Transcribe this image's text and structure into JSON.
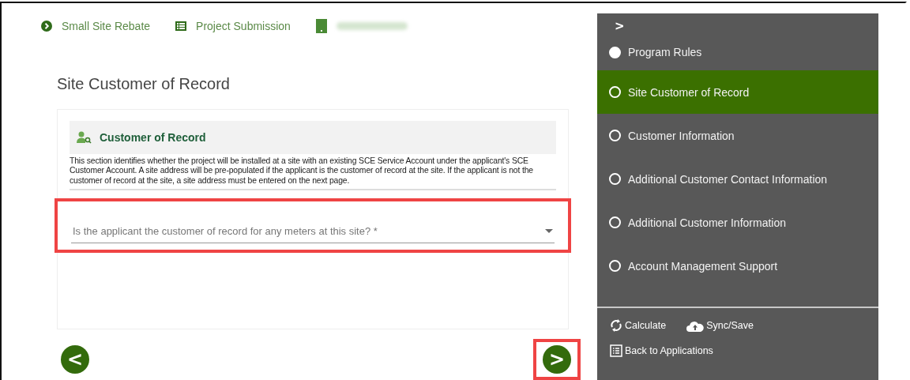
{
  "breadcrumbs": [
    {
      "label": "Small Site Rebate",
      "kind": "chevron"
    },
    {
      "label": "Project Submission",
      "kind": "list"
    },
    {
      "kind": "redacted"
    }
  ],
  "page_title": "Site Customer of Record",
  "section": {
    "title": "Customer of Record",
    "description": "This section identifies whether the project will be installed at a site with an existing SCE Service Account under the applicant's SCE Customer Account. A site address will be pre-populated if the applicant is the customer of record at the site. If the applicant is not the customer of record at the site, a site address must be entered on the next page."
  },
  "question": {
    "placeholder": "Is the applicant the customer of record for any meters at this site? *",
    "highlighted": true
  },
  "nav": {
    "prev": {
      "label": "<",
      "highlighted": false
    },
    "next": {
      "label": ">",
      "highlighted": true
    }
  },
  "sidebar": {
    "toggle": ">",
    "steps": [
      {
        "label": "Program Rules",
        "completed": true,
        "selected": false
      },
      {
        "label": "Site Customer of Record",
        "completed": false,
        "selected": true
      },
      {
        "label": "Customer Information",
        "completed": false,
        "selected": false
      },
      {
        "label": "Additional Customer Contact Information",
        "completed": false,
        "selected": false
      },
      {
        "label": "Additional Customer Information",
        "completed": false,
        "selected": false
      },
      {
        "label": "Account Management Support",
        "completed": false,
        "selected": false
      }
    ],
    "actions": [
      {
        "label": "Calculate",
        "kind": "calculate"
      },
      {
        "label": "Sync/Save",
        "kind": "save"
      },
      {
        "label": "Back to Applications",
        "kind": "back"
      }
    ]
  }
}
